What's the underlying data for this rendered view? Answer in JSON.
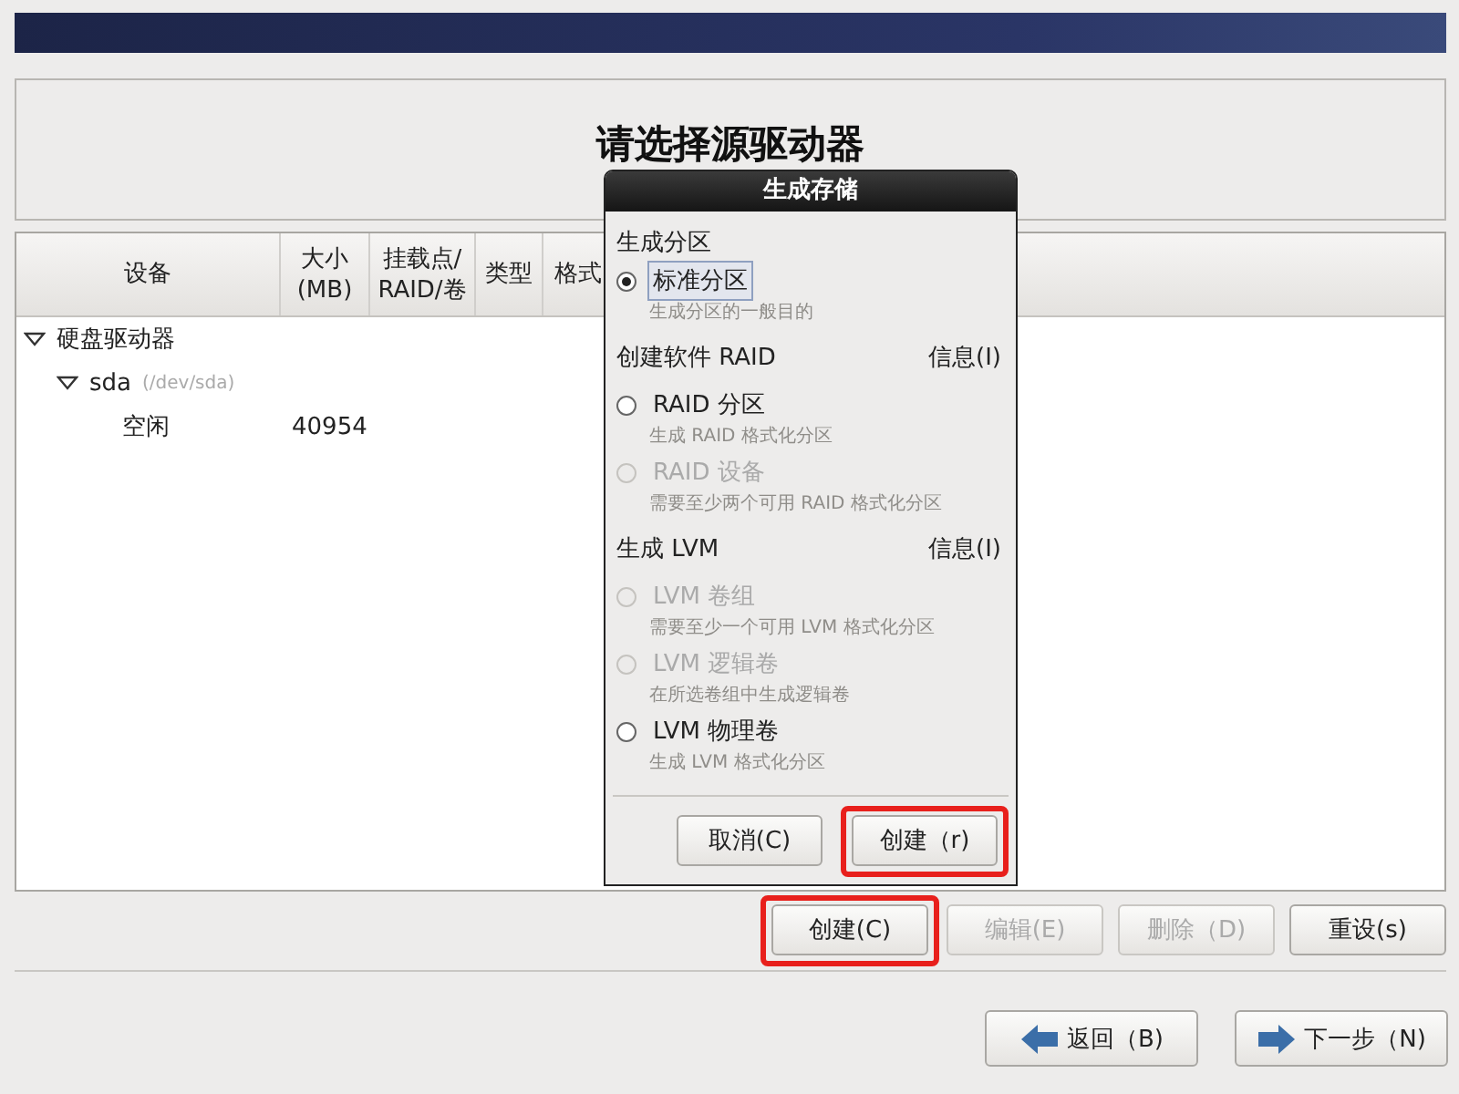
{
  "title": "请选择源驱动器",
  "table": {
    "columns": [
      {
        "label": "设备"
      },
      {
        "label": "大小\n(MB)"
      },
      {
        "label": "挂载点/\nRAID/卷"
      },
      {
        "label": "类型"
      },
      {
        "label": "格式"
      }
    ],
    "rows": [
      {
        "device": "硬盘驱动器",
        "expanded": true,
        "children": [
          {
            "device": "sda",
            "path": "(/dev/sda)",
            "expanded": true,
            "children": [
              {
                "device": "空闲",
                "size": "40954"
              }
            ]
          }
        ]
      }
    ]
  },
  "action_buttons": [
    {
      "label": "创建(C)",
      "disabled": false,
      "highlighted": true
    },
    {
      "label": "编辑(E)",
      "disabled": true,
      "highlighted": false
    },
    {
      "label": "删除（D)",
      "disabled": true,
      "highlighted": false
    },
    {
      "label": "重设(s)",
      "disabled": false,
      "highlighted": false
    }
  ],
  "nav_buttons": [
    {
      "label": "返回（B)",
      "kind": "back"
    },
    {
      "label": "下一步（N)",
      "kind": "forward"
    }
  ],
  "dialog": {
    "title": "生成存储",
    "sections": [
      {
        "heading": "生成分区",
        "options": [
          {
            "label": "标准分区",
            "description": "生成分区的一般目的",
            "selected": true,
            "disabled": false,
            "focused": true
          }
        ]
      },
      {
        "heading": "创建软件 RAID",
        "info": "信息(I)",
        "options": [
          {
            "label": "RAID 分区",
            "description": "生成 RAID 格式化分区",
            "selected": false,
            "disabled": false,
            "focused": false
          },
          {
            "label": "RAID 设备",
            "description": "需要至少两个可用 RAID 格式化分区",
            "selected": false,
            "disabled": true,
            "focused": false
          }
        ]
      },
      {
        "heading": "生成 LVM",
        "info": "信息(I)",
        "options": [
          {
            "label": "LVM 卷组",
            "description": "需要至少一个可用 LVM 格式化分区",
            "selected": false,
            "disabled": true,
            "focused": false
          },
          {
            "label": "LVM 逻辑卷",
            "description": "在所选卷组中生成逻辑卷",
            "selected": false,
            "disabled": true,
            "focused": false
          },
          {
            "label": "LVM 物理卷",
            "description": "生成 LVM 格式化分区",
            "selected": false,
            "disabled": false,
            "focused": false
          }
        ]
      }
    ],
    "buttons": [
      {
        "label": "取消(C)",
        "highlighted": false
      },
      {
        "label": "创建（r)",
        "highlighted": true
      }
    ]
  }
}
